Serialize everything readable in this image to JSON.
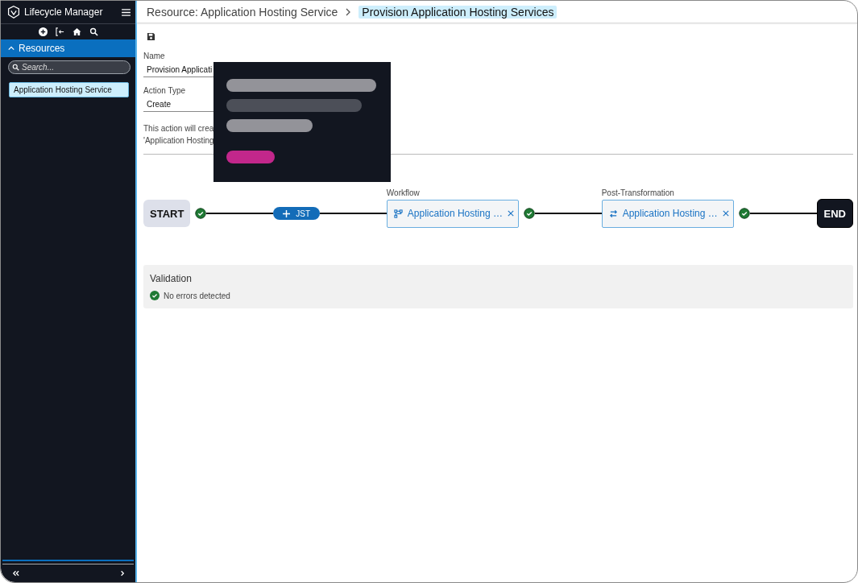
{
  "app": {
    "title": "Lifecycle Manager"
  },
  "sidebar": {
    "section": {
      "label": "Resources",
      "expanded": true
    },
    "search": {
      "placeholder": "Search..."
    },
    "items": [
      {
        "label": "Application Hosting Service",
        "selected": true
      }
    ]
  },
  "breadcrumb": [
    {
      "label": "Resource: Application Hosting Service",
      "selected": false
    },
    {
      "label": "Provision Application Hosting Services",
      "selected": true
    }
  ],
  "form": {
    "fields": [
      {
        "label": "Name",
        "value": "Provision Applicati"
      },
      {
        "label": "Action Type",
        "value": "Create"
      }
    ],
    "description": [
      "This action will crea",
      "'Application Hosting"
    ]
  },
  "pipeline": [
    {
      "kind": "terminal",
      "label": "START",
      "dark": false
    },
    {
      "kind": "check"
    },
    {
      "kind": "add",
      "label": "JST"
    },
    {
      "kind": "workflow",
      "heading": "Workflow",
      "label": "Application Hosting …"
    },
    {
      "kind": "check"
    },
    {
      "kind": "transform",
      "heading": "Post-Transformation",
      "label": "Application Hosting …"
    },
    {
      "kind": "check"
    },
    {
      "kind": "terminal",
      "label": "END",
      "dark": true
    }
  ],
  "validation": {
    "title": "Validation",
    "message": "No errors detected",
    "ok": true
  }
}
